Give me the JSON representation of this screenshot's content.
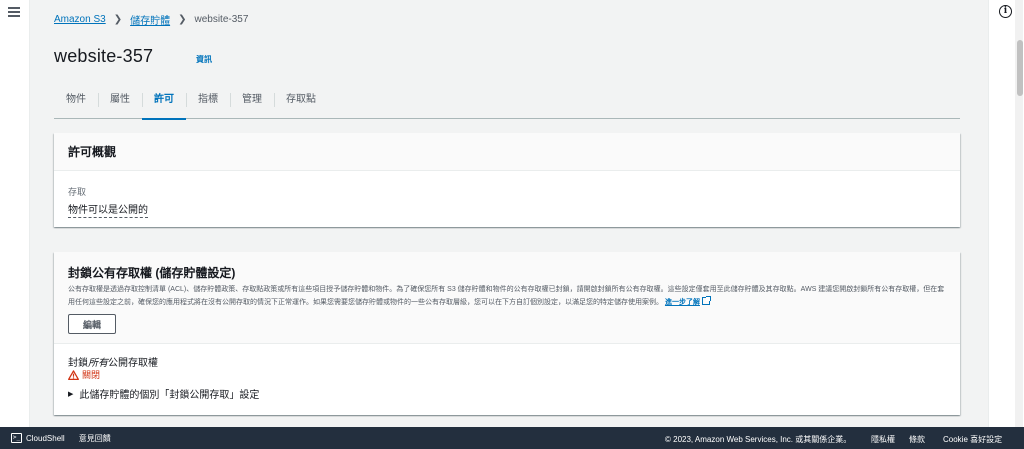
{
  "breadcrumb": {
    "root": "Amazon S3",
    "section": "儲存貯體",
    "current": "website-357"
  },
  "page": {
    "title": "website-357",
    "info_link": "資訊"
  },
  "tabs": [
    {
      "label": "物件",
      "active": false
    },
    {
      "label": "屬性",
      "active": false
    },
    {
      "label": "許可",
      "active": true
    },
    {
      "label": "指標",
      "active": false
    },
    {
      "label": "管理",
      "active": false
    },
    {
      "label": "存取點",
      "active": false
    }
  ],
  "overview": {
    "heading": "許可概觀",
    "access_label": "存取",
    "access_value": "物件可以是公開的"
  },
  "block_public": {
    "heading": "封鎖公有存取權 (儲存貯體設定)",
    "description": "公有存取權是透過存取控制清單 (ACL)、儲存貯體政策、存取點政策或所有這些項目授予儲存貯體和物件。為了確保您所有 S3 儲存貯體和物件的公有存取權已封鎖，請開啟封鎖所有公有存取權。這些設定僅套用至此儲存貯體及其存取點。AWS 建議您開啟封鎖所有公有存取權，但在套用任何這些設定之前，確保您的應用程式將在沒有公開存取的情況下正常運作。如果您需要您儲存貯體或物件的一些公有存取層級，您可以在下方自訂個別設定，以滿足您的特定儲存使用案例。",
    "learn_more": "進一步了解",
    "edit_button": "編輯",
    "block_all_prefix": "封鎖",
    "block_all_italic": "所有",
    "block_all_suffix": "公開存取權",
    "status": "關閉",
    "expander": "此儲存貯體的個別「封鎖公開存取」設定"
  },
  "footer": {
    "cloudshell": "CloudShell",
    "feedback": "意見回饋",
    "copyright": "© 2023, Amazon Web Services, Inc. 或其關係企業。",
    "privacy": "隱私權",
    "terms": "條款",
    "cookie": "Cookie 喜好設定"
  },
  "colors": {
    "link": "#0073bb",
    "warning": "#d13212",
    "footer_bg": "#232f3e"
  },
  "icons": [
    "menu-icon",
    "info-icon",
    "external-link-icon",
    "warning-icon",
    "caret-right-icon",
    "cloudshell-icon"
  ]
}
